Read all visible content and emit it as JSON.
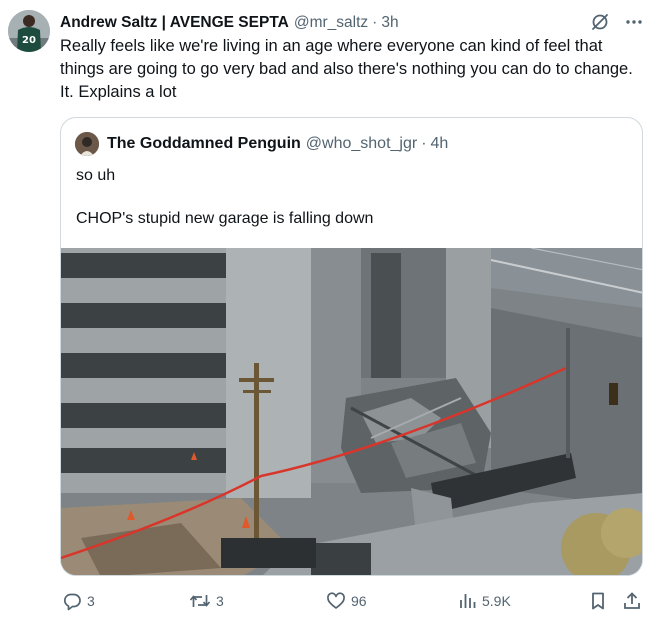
{
  "tweet": {
    "author": {
      "display_name": "Andrew Saltz | AVENGE SEPTA",
      "handle": "@mr_saltz",
      "time": "3h",
      "avatar_icon": "avatar-jersey-20"
    },
    "text": "Really feels like we're living in an age where everyone can kind of feel that things are going to go very bad and also there's nothing you can do to change. It. Explains a lot",
    "header_icons": [
      "grok-icon",
      "more-icon"
    ]
  },
  "quote": {
    "author": {
      "display_name": "The Goddamned Penguin",
      "handle": "@who_shot_jgr",
      "time": "4h"
    },
    "text_line1": "so uh",
    "text_line2": "CHOP's stupid new garage is falling down",
    "media": "photo-collapsed-parking-garage"
  },
  "actions": {
    "replies": "3",
    "retweets": "3",
    "likes": "96",
    "views": "5.9K",
    "icons": [
      "reply-icon",
      "retweet-icon",
      "like-icon",
      "views-icon",
      "bookmark-icon",
      "share-icon"
    ]
  },
  "colors": {
    "text_primary": "#0f1419",
    "text_secondary": "#536471",
    "border": "#cfd9de"
  }
}
